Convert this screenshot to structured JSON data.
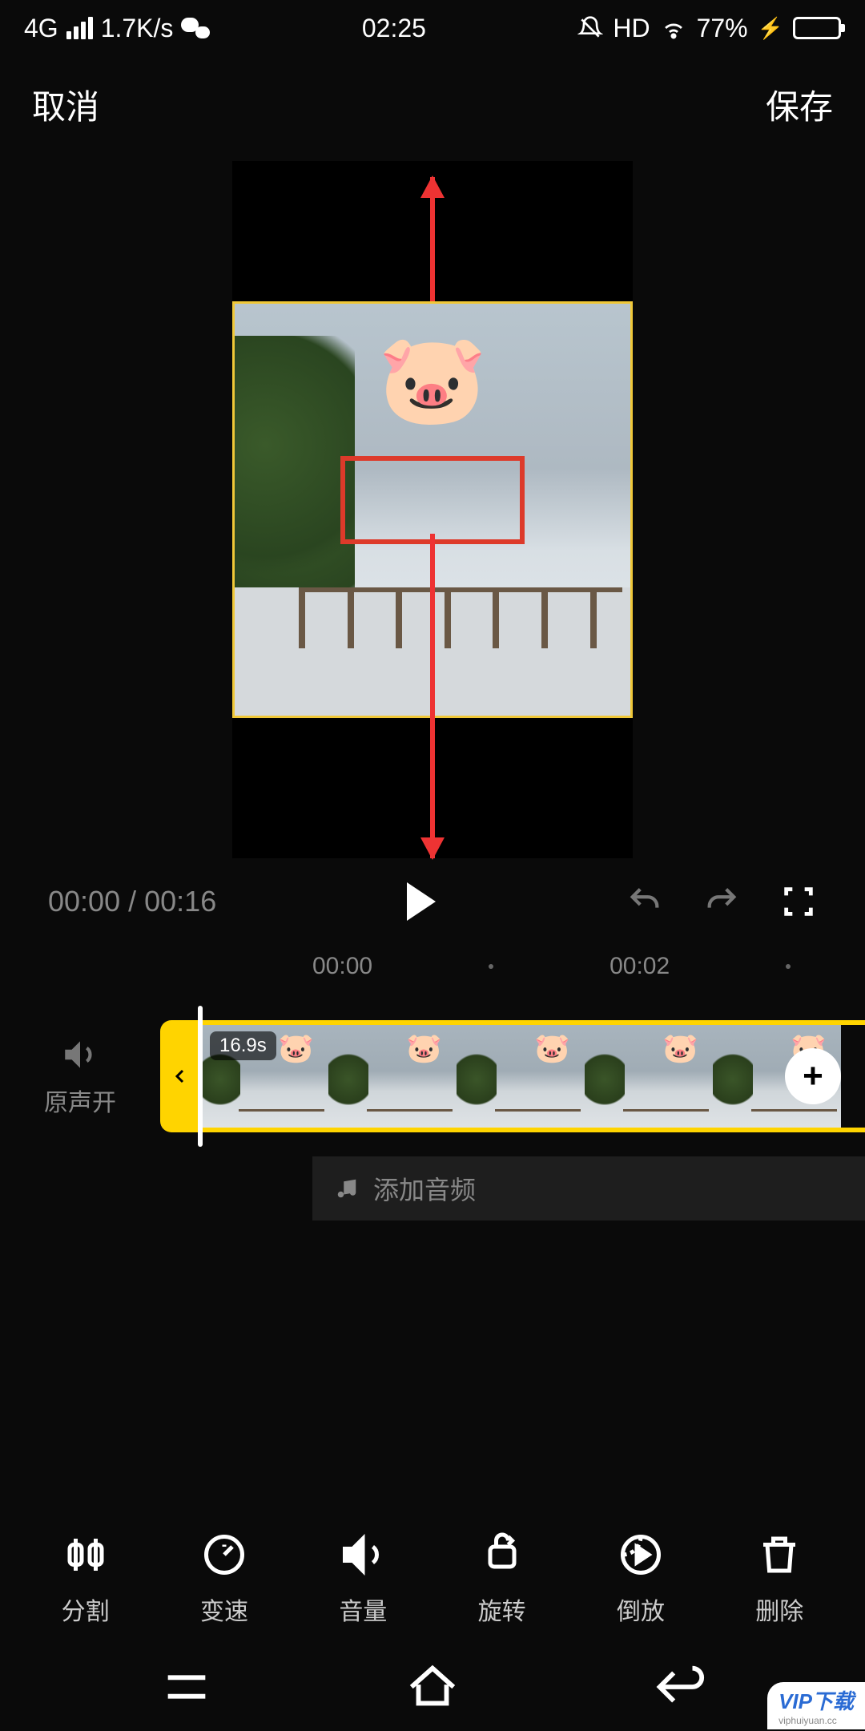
{
  "status": {
    "network": "4G",
    "speed": "1.7K/s",
    "time": "02:25",
    "hd": "HD",
    "battery_pct": "77%"
  },
  "header": {
    "cancel": "取消",
    "save": "保存"
  },
  "playback": {
    "current": "00:00",
    "sep": "/",
    "total": "00:16"
  },
  "ruler": {
    "t0": "00:00",
    "t1": "00:02"
  },
  "timeline": {
    "sound_label": "原声开",
    "clip_duration": "16.9s",
    "add_audio": "添加音频"
  },
  "tools": {
    "split": "分割",
    "speed": "变速",
    "volume": "音量",
    "rotate": "旋转",
    "reverse": "倒放",
    "delete": "删除"
  },
  "watermark": {
    "brand": "VIP下载",
    "url": "viphuiyuan.cc"
  },
  "colors": {
    "accent": "#ffd400",
    "annotation": "#e33"
  }
}
